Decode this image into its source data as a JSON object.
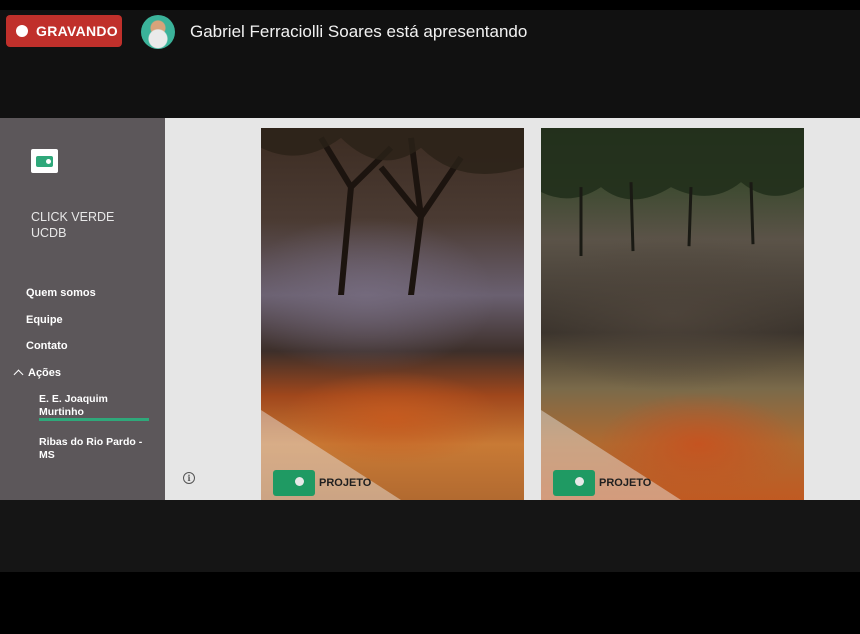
{
  "recording": {
    "label": "GRAVANDO",
    "color": "#c0302b"
  },
  "presenter": {
    "text": "Gabriel Ferraciolli Soares está apresentando"
  },
  "site": {
    "name": "CLICK VERDE UCDB",
    "accent_color": "#2fa87a",
    "nav": [
      "Quem somos",
      "Equipe",
      "Contato"
    ],
    "section": "Ações",
    "sub_items": [
      "E. E. Joaquim Murtinho",
      "Ribas do Rio Pardo - MS"
    ]
  },
  "photos": [
    {
      "icon": "forest-fire-photo",
      "brand": "PROJETO"
    },
    {
      "icon": "burnt-ground-photo",
      "brand": "PROJETO"
    }
  ],
  "icons": {
    "info": "info-icon",
    "logo": "camera-logo-icon"
  }
}
